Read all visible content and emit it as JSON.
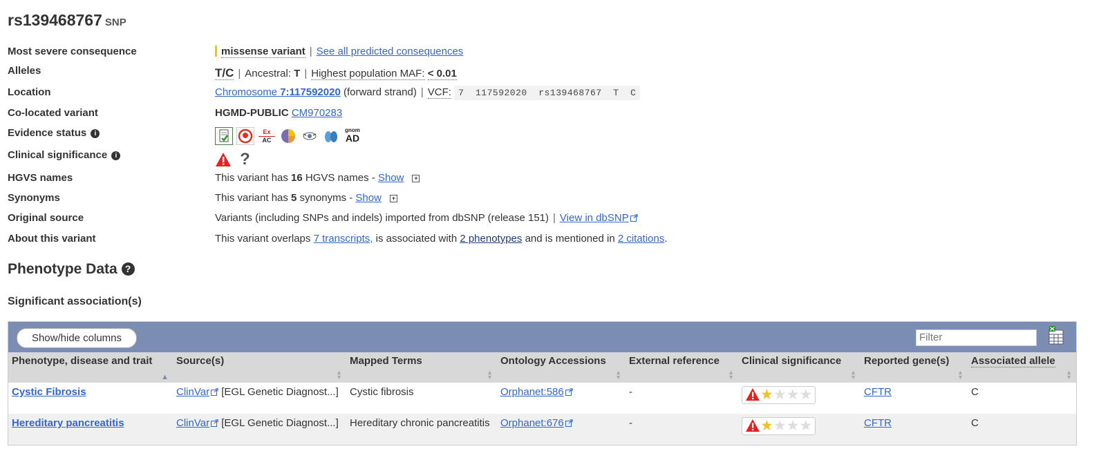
{
  "header": {
    "rsid": "rs139468767",
    "type": "SNP"
  },
  "summary": {
    "consequence": {
      "label": "Most severe consequence",
      "value": "missense variant",
      "link": "See all predicted consequences"
    },
    "alleles": {
      "label": "Alleles",
      "value": "T/C",
      "ancestral_label": "Ancestral:",
      "ancestral": "T",
      "maf_label": "Highest population MAF:",
      "maf": "< 0.01"
    },
    "location": {
      "label": "Location",
      "chrom_prefix": "Chromosome ",
      "chrom_pos": "7:117592020",
      "strand": " (forward strand)",
      "vcf_label": "VCF:",
      "vcf": "7  117592020  rs139468767  T  C"
    },
    "colocated": {
      "label": "Co-located variant",
      "source": "HGMD-PUBLIC",
      "id": "CM970283"
    },
    "evidence": {
      "label": "Evidence status",
      "icons": [
        "Ex",
        "AC",
        "gnom",
        "AD"
      ]
    },
    "clinical": {
      "label": "Clinical significance",
      "unknown": "?"
    },
    "hgvs": {
      "label": "HGVS names",
      "pre": "This variant has ",
      "count": "16",
      "post": " HGVS names - ",
      "link": "Show"
    },
    "synonyms": {
      "label": "Synonyms",
      "pre": "This variant has ",
      "count": "5",
      "post": " synonyms - ",
      "link": "Show"
    },
    "original": {
      "label": "Original source",
      "text": "Variants (including SNPs and indels) imported from dbSNP (release 151)",
      "link": "View in dbSNP"
    },
    "about": {
      "label": "About this variant",
      "t1": "This variant overlaps ",
      "l1": "7 transcripts,",
      "t2": " is associated with ",
      "l2": "2 phenotypes",
      "t3": " and is mentioned in ",
      "l3": "2 citations",
      "t4": "."
    }
  },
  "phenotype": {
    "heading": "Phenotype Data",
    "subheading": "Significant association(s)",
    "toolbar": {
      "show_hide": "Show/hide columns",
      "filter_placeholder": "Filter"
    },
    "columns": [
      "Phenotype, disease and trait",
      "Source(s)",
      "Mapped Terms",
      "Ontology Accessions",
      "External reference",
      "Clinical significance",
      "Reported gene(s)",
      "Associated allele"
    ],
    "rows": [
      {
        "trait": "Cystic Fibrosis",
        "source_link": "ClinVar",
        "source_rest": " [EGL Genetic Diagnost...]",
        "mapped": "Cystic fibrosis",
        "ontology": "Orphanet:586",
        "external": "-",
        "gene": "CFTR",
        "allele": "C"
      },
      {
        "trait": "Hereditary pancreatitis",
        "source_link": "ClinVar",
        "source_rest": " [EGL Genetic Diagnost...]",
        "mapped": "Hereditary chronic pancreatitis",
        "ontology": "Orphanet:676",
        "external": "-",
        "gene": "CFTR",
        "allele": "C"
      }
    ]
  },
  "colors": {
    "accent_link": "#3366cc",
    "toolbar": "#7b8db3",
    "consequence_bar": "#f5c400",
    "warning": "#e8201f"
  }
}
